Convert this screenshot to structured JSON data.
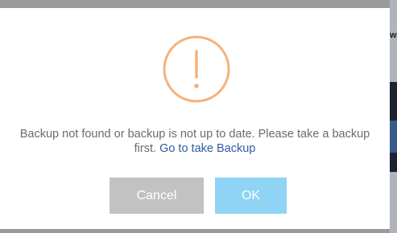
{
  "dialog": {
    "icon": "exclamation-circle-icon",
    "icon_color": "#f5b27c",
    "message_text": "Backup not found or backup is not up to date. Please take a backup first.",
    "link_text": "Go to take Backup",
    "cancel_label": "Cancel",
    "ok_label": "OK"
  },
  "colors": {
    "cancel_button": "#c2c2c2",
    "ok_button": "#8fd4f4",
    "link": "#2f5d9e",
    "message_text": "#6b6b6b"
  }
}
